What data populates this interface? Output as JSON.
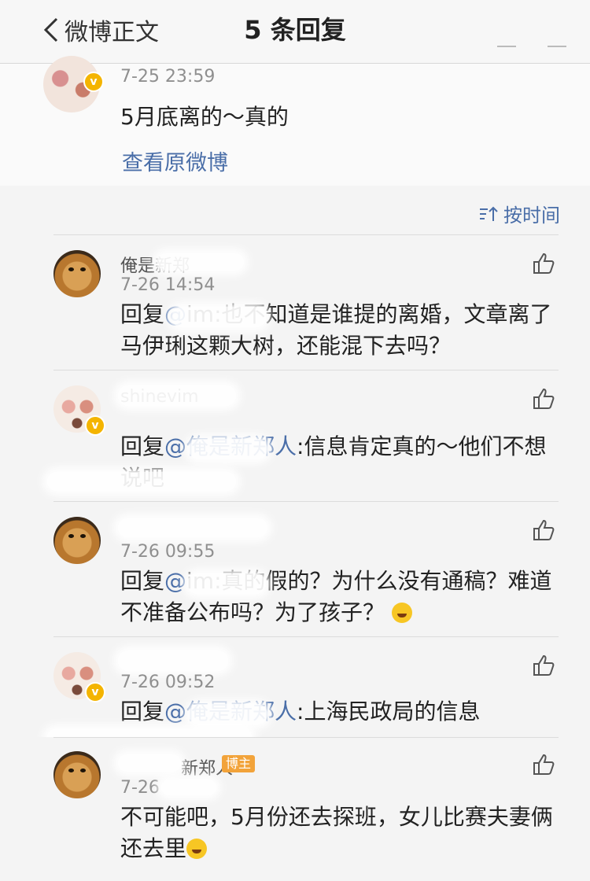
{
  "header": {
    "back_label": "微博正文",
    "title": "5 条回复"
  },
  "original": {
    "time": "7-25 23:59",
    "text": "5月底离的～真的",
    "view_original": "查看原微博"
  },
  "sort": {
    "label": "按时间",
    "icon": "sort-time-icon"
  },
  "comments": [
    {
      "username": "俺是新郑",
      "time": "7-26 14:54",
      "reply_prefix": "回复",
      "mention": "@",
      "text": "im:也不知道是谁提的离婚，文章离了马伊琍这颗大树，还能混下去吗？"
    },
    {
      "username": "shinevim",
      "time": "",
      "reply_prefix": "回复",
      "mention": "@俺是新郑人",
      "text": ":信息肯定真的～他们不想说吧"
    },
    {
      "username": "",
      "time": "7-26 09:55",
      "reply_prefix": "回复",
      "mention": "@",
      "text": "im:真的假的？为什么没有通稿？难道不准备公布吗？为了孩子？"
    },
    {
      "username": "",
      "time": "7-26 09:52",
      "reply_prefix": "回复",
      "mention": "@俺是新郑人",
      "text": ":上海民政局的信息"
    },
    {
      "username": "新郑人",
      "badge": "博主",
      "time": "7-26",
      "reply_prefix": "",
      "mention": "",
      "text": "不可能吧，5月份还去探班，女儿比赛夫妻俩还去里"
    }
  ],
  "colors": {
    "link": "#4a6ea8",
    "host_badge": "#f2a33a",
    "verified": "#f4b400"
  }
}
